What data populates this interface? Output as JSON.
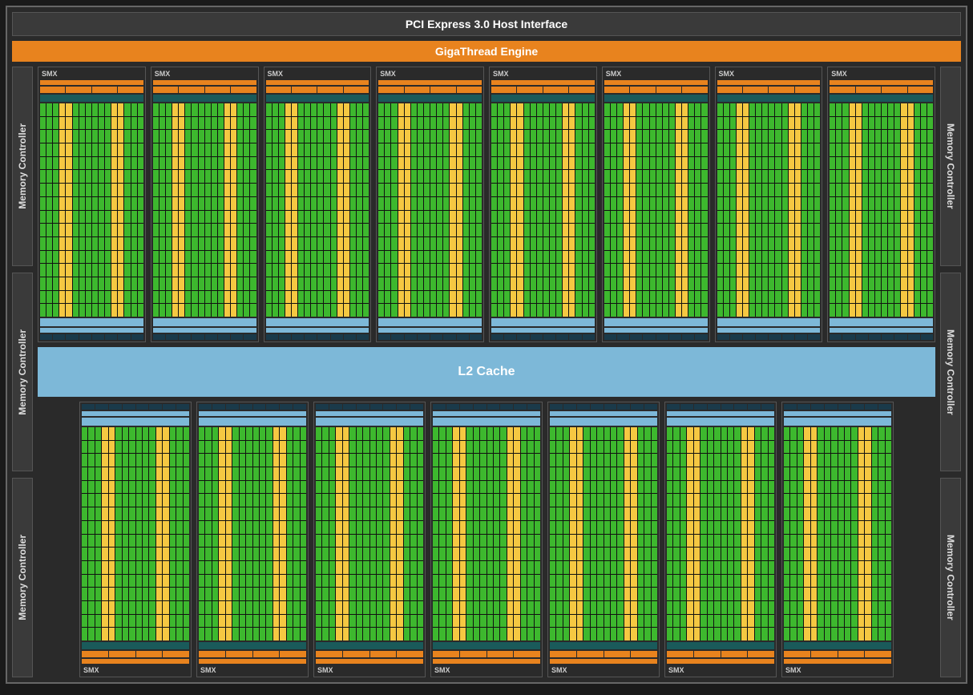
{
  "pci_label": "PCI Express 3.0 Host Interface",
  "gigathread_label": "GigaThread Engine",
  "l2_label": "L2 Cache",
  "smx_label": "SMX",
  "mem_ctrl_label": "Memory Controller",
  "architecture": {
    "smx_count_top": 8,
    "smx_count_bottom": 7,
    "mem_controllers_per_side": 3,
    "core_grid_cols": 16,
    "core_grid_rows": 16,
    "yellow_columns": [
      3,
      4,
      11,
      12
    ],
    "colors": {
      "cuda_core": "#3db82e",
      "sfu_or_ldst": "#f5c842",
      "dispatch": "#e8831e",
      "l1_shared": "#7db8d8",
      "register_file": "#1a5a5a",
      "background": "#2a2a2a"
    }
  }
}
